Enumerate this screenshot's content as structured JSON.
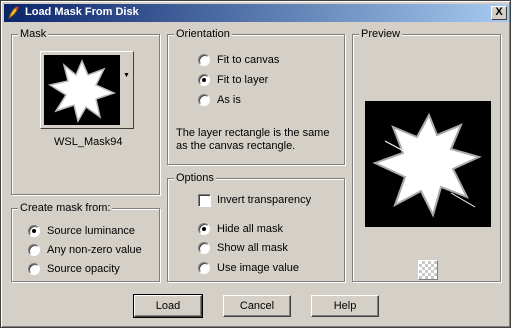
{
  "window": {
    "title": "Load Mask From Disk",
    "close_label": "X"
  },
  "mask": {
    "legend": "Mask",
    "name": "WSL_Mask94"
  },
  "create_from": {
    "legend": "Create mask from:",
    "options": [
      "Source luminance",
      "Any non-zero value",
      "Source opacity"
    ],
    "selected": "Source luminance"
  },
  "orientation": {
    "legend": "Orientation",
    "options": [
      "Fit to canvas",
      "Fit to layer",
      "As is"
    ],
    "selected": "Fit to layer",
    "note": "The layer rectangle is the same as the canvas rectangle."
  },
  "options": {
    "legend": "Options",
    "invert_label": "Invert transparency",
    "invert_checked": false,
    "radios": [
      "Hide all mask",
      "Show all mask",
      "Use image value"
    ],
    "selected": "Hide all mask"
  },
  "preview": {
    "legend": "Preview"
  },
  "buttons": {
    "load": "Load",
    "cancel": "Cancel",
    "help": "Help"
  }
}
